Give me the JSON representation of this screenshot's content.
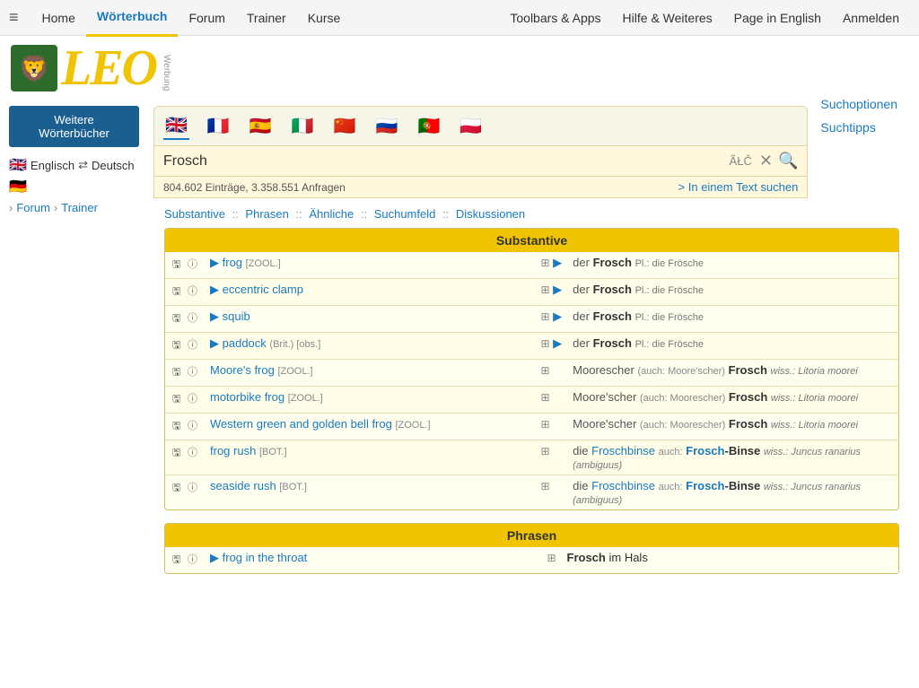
{
  "nav": {
    "hamburger": "≡",
    "items": [
      {
        "label": "Home",
        "active": false
      },
      {
        "label": "Wörterbuch",
        "active": true
      },
      {
        "label": "Forum",
        "active": false
      },
      {
        "label": "Trainer",
        "active": false
      },
      {
        "label": "Kurse",
        "active": false
      }
    ],
    "right_items": [
      {
        "label": "Toolbars & Apps"
      },
      {
        "label": "Hilfe & Weiteres"
      },
      {
        "label": "Page in English"
      },
      {
        "label": "Anmelden"
      }
    ]
  },
  "logo": {
    "lion_emoji": "🦁",
    "text": "LEO",
    "werbung": "Werbung"
  },
  "sidebar": {
    "btn_label": "Weitere Wörterbücher",
    "lang_from_flag": "🇬🇧",
    "lang_from": "Englisch",
    "arrows": "⇄",
    "lang_to_flag": "🇩🇪",
    "lang_to": "Deutsch",
    "forum_label": "Forum",
    "trainer_label": "Trainer"
  },
  "search": {
    "flags": [
      "🇬🇧",
      "🇫🇷",
      "🇪🇸",
      "🇮🇹",
      "🇨🇳",
      "🇷🇺",
      "🇵🇹",
      "🇵🇱"
    ],
    "value": "Frosch",
    "atc_label": "ÃŁČ",
    "stats": "804.602 Einträge, 3.358.551 Anfragen",
    "text_search_label": "> In einem Text suchen"
  },
  "search_options": {
    "option1": "Suchoptionen",
    "option2": "Suchtipps"
  },
  "section_tabs": {
    "items": [
      "Substantive",
      "Phrasen",
      "Ähnliche",
      "Suchumfeld",
      "Diskussionen"
    ]
  },
  "substantive": {
    "header": "Substantive",
    "rows": [
      {
        "en_play": true,
        "en_word": "frog",
        "en_tag": "[ZOOL.]",
        "en_obs": "",
        "de_grid": true,
        "de_play": true,
        "de_artikel": "der",
        "de_word": "Frosch",
        "de_plural": "Pl.: die Frösche",
        "de_wiss": ""
      },
      {
        "en_play": true,
        "en_word": "eccentric clamp",
        "en_tag": "",
        "en_obs": "",
        "de_grid": true,
        "de_play": true,
        "de_artikel": "der",
        "de_word": "Frosch",
        "de_plural": "Pl.: die Frösche",
        "de_wiss": ""
      },
      {
        "en_play": true,
        "en_word": "squib",
        "en_tag": "",
        "en_obs": "",
        "de_grid": true,
        "de_play": true,
        "de_artikel": "der",
        "de_word": "Frosch",
        "de_plural": "Pl.: die Frösche",
        "de_wiss": ""
      },
      {
        "en_play": true,
        "en_word": "paddock",
        "en_tag": "(Brit.) [obs.]",
        "en_obs": "",
        "de_grid": true,
        "de_play": true,
        "de_artikel": "der",
        "de_word": "Frosch",
        "de_plural": "Pl.: die Frösche",
        "de_wiss": ""
      },
      {
        "en_play": false,
        "en_word": "Moore's frog",
        "en_tag": "[ZOOL.]",
        "en_obs": "",
        "de_grid": true,
        "de_play": false,
        "de_artikel": "Moorescher",
        "de_also": "(auch: Moore'scher)",
        "de_word": "Frosch",
        "de_plural": "",
        "de_wiss": "wiss.: Litoria moorei"
      },
      {
        "en_play": false,
        "en_word": "motorbike frog",
        "en_tag": "[ZOOL.]",
        "en_obs": "",
        "de_grid": true,
        "de_play": false,
        "de_artikel": "Moore'scher",
        "de_also": "(auch: Moorescher)",
        "de_word": "Frosch",
        "de_plural": "",
        "de_wiss": "wiss.: Litoria moorei"
      },
      {
        "en_play": false,
        "en_word": "Western green and golden bell frog",
        "en_tag": "[ZOOL.]",
        "en_obs": "",
        "de_grid": true,
        "de_play": false,
        "de_artikel": "Moore'scher",
        "de_also": "(auch: Moorescher)",
        "de_word": "Frosch",
        "de_plural": "",
        "de_wiss": "wiss.: Litoria moorei"
      },
      {
        "en_play": false,
        "en_word": "frog rush",
        "en_tag": "[BOT.]",
        "en_obs": "",
        "de_grid": true,
        "de_play": false,
        "de_artikel": "die",
        "de_word_prefix": "Froschbinse",
        "de_also": "auch:",
        "de_word_alt": "Frosch-Binse",
        "de_plural": "",
        "de_wiss": "wiss.: Juncus ranarius (ambiguus)"
      },
      {
        "en_play": false,
        "en_word": "seaside rush",
        "en_tag": "[BOT.]",
        "en_obs": "",
        "de_grid": true,
        "de_play": false,
        "de_artikel": "die",
        "de_word_prefix": "Froschbinse",
        "de_also": "auch:",
        "de_word_alt": "Frosch-Binse",
        "de_plural": "",
        "de_wiss": "wiss.: Juncus ranarius (ambiguus)"
      }
    ]
  },
  "phrasen": {
    "header": "Phrasen",
    "rows": [
      {
        "en_play": true,
        "en_word": "frog in the throat",
        "de_grid": true,
        "de_play": false,
        "de_artikel": "Frosch",
        "de_word": "im Hals"
      }
    ]
  }
}
